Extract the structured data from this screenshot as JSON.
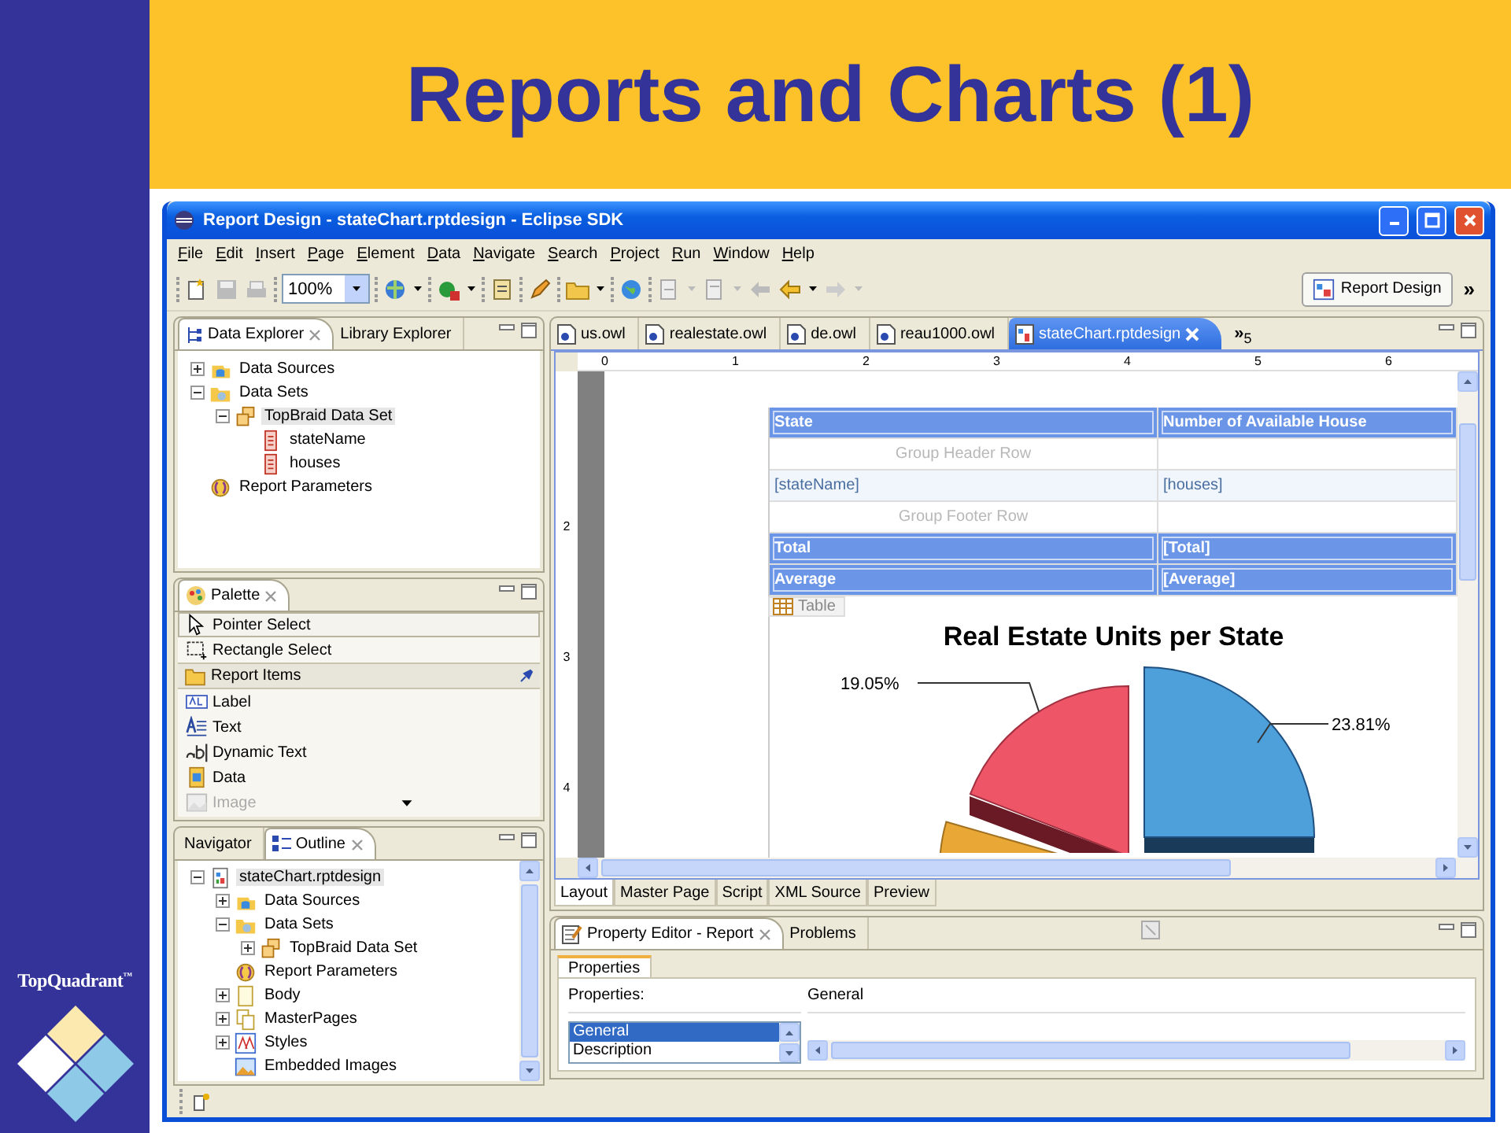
{
  "slide": {
    "title": "Reports and Charts (1)",
    "logo": "TopQuadrant",
    "logo_mark": "™"
  },
  "window": {
    "title": "Report Design - stateChart.rptdesign - Eclipse SDK"
  },
  "menu": [
    "File",
    "Edit",
    "Insert",
    "Page",
    "Element",
    "Data",
    "Navigate",
    "Search",
    "Project",
    "Run",
    "Window",
    "Help"
  ],
  "toolbar": {
    "zoom": "100%",
    "perspective": "Report Design",
    "overflow": "»"
  },
  "data_explorer": {
    "tabs": [
      {
        "label": "Data Explorer",
        "selected": true
      },
      {
        "label": "Library Explorer",
        "selected": false
      }
    ],
    "tree": [
      {
        "label": "Data Sources",
        "kind": "datasource",
        "expandable": true,
        "expanded": false,
        "selected": false
      },
      {
        "label": "Data Sets",
        "kind": "datasets",
        "expandable": true,
        "expanded": true,
        "selected": false,
        "children": [
          {
            "label": "TopBraid Data Set",
            "kind": "dataset",
            "expandable": true,
            "expanded": true,
            "selected": true,
            "children": [
              {
                "label": "stateName",
                "kind": "column",
                "expandable": false,
                "expanded": false,
                "selected": false
              },
              {
                "label": "houses",
                "kind": "column",
                "expandable": false,
                "expanded": false,
                "selected": false
              }
            ]
          }
        ]
      },
      {
        "label": "Report Parameters",
        "kind": "parameters",
        "expandable": false,
        "expanded": false,
        "selected": false
      }
    ]
  },
  "palette": {
    "tab": "Palette",
    "tools": [
      {
        "label": "Pointer Select",
        "kind": "pointer",
        "selected": true
      },
      {
        "label": "Rectangle Select",
        "kind": "marquee",
        "selected": false
      }
    ],
    "drawer": "Report Items",
    "items": [
      {
        "label": "Label",
        "kind": "label",
        "disabled": false
      },
      {
        "label": "Text",
        "kind": "text",
        "disabled": false
      },
      {
        "label": "Dynamic Text",
        "kind": "dynamic",
        "disabled": false
      },
      {
        "label": "Data",
        "kind": "data",
        "disabled": false
      },
      {
        "label": "Image",
        "kind": "image",
        "disabled": true
      }
    ]
  },
  "outline": {
    "tabs": [
      {
        "label": "Navigator",
        "selected": false
      },
      {
        "label": "Outline",
        "selected": true
      }
    ],
    "tree": [
      {
        "label": "stateChart.rptdesign",
        "kind": "report",
        "expandable": true,
        "expanded": true,
        "selected": true,
        "children": [
          {
            "label": "Data Sources",
            "kind": "datasource",
            "expandable": true,
            "expanded": false,
            "selected": false
          },
          {
            "label": "Data Sets",
            "kind": "datasets",
            "expandable": true,
            "expanded": true,
            "selected": false,
            "children": [
              {
                "label": "TopBraid Data Set",
                "kind": "dataset",
                "expandable": true,
                "expanded": false,
                "selected": false
              }
            ]
          },
          {
            "label": "Report Parameters",
            "kind": "parameters",
            "expandable": false,
            "expanded": false,
            "selected": false
          },
          {
            "label": "Body",
            "kind": "body",
            "expandable": true,
            "expanded": false,
            "selected": false
          },
          {
            "label": "MasterPages",
            "kind": "masterpages",
            "expandable": true,
            "expanded": false,
            "selected": false
          },
          {
            "label": "Styles",
            "kind": "styles",
            "expandable": true,
            "expanded": false,
            "selected": false
          },
          {
            "label": "Embedded Images",
            "kind": "images",
            "expandable": false,
            "expanded": false,
            "selected": false
          }
        ]
      }
    ]
  },
  "editor": {
    "tabs": [
      {
        "label": "us.owl",
        "selected": false
      },
      {
        "label": "realestate.owl",
        "selected": false
      },
      {
        "label": "de.owl",
        "selected": false
      },
      {
        "label": "reau1000.owl",
        "selected": false
      },
      {
        "label": "stateChart.rptdesign",
        "selected": true
      }
    ],
    "overflow": "»",
    "overflow_count": "5",
    "ruler_h": [
      "0",
      "1",
      "2",
      "3",
      "4",
      "5",
      "6"
    ],
    "ruler_v": [
      "2",
      "3",
      "4"
    ],
    "table_rows": [
      {
        "kind": "header",
        "cells": [
          "State",
          "Number of Available House"
        ]
      },
      {
        "kind": "group",
        "cells": [
          "Group Header Row"
        ]
      },
      {
        "kind": "detail",
        "cells": [
          "[stateName]",
          "[houses]"
        ]
      },
      {
        "kind": "group",
        "cells": [
          "Group Footer Row"
        ]
      },
      {
        "kind": "footer",
        "cells": [
          "Total",
          "[Total]"
        ]
      },
      {
        "kind": "footer",
        "cells": [
          "Average",
          "[Average]"
        ]
      }
    ],
    "table_tag": "Table",
    "chart": {
      "title": "Real Estate Units per State",
      "labels": [
        "19.05%",
        "23.81%"
      ]
    },
    "bottom_tabs": [
      {
        "label": "Layout",
        "selected": true
      },
      {
        "label": "Master Page",
        "selected": false
      },
      {
        "label": "Script",
        "selected": false
      },
      {
        "label": "XML Source",
        "selected": false
      },
      {
        "label": "Preview",
        "selected": false
      }
    ]
  },
  "property_editor": {
    "tabs": [
      {
        "label": "Property Editor - Report",
        "selected": true
      },
      {
        "label": "Problems",
        "selected": false
      }
    ],
    "inner_tab": "Properties",
    "label": "Properties:",
    "heading": "General",
    "list": [
      {
        "label": "General",
        "selected": true
      },
      {
        "label": "Description",
        "selected": false
      }
    ]
  }
}
